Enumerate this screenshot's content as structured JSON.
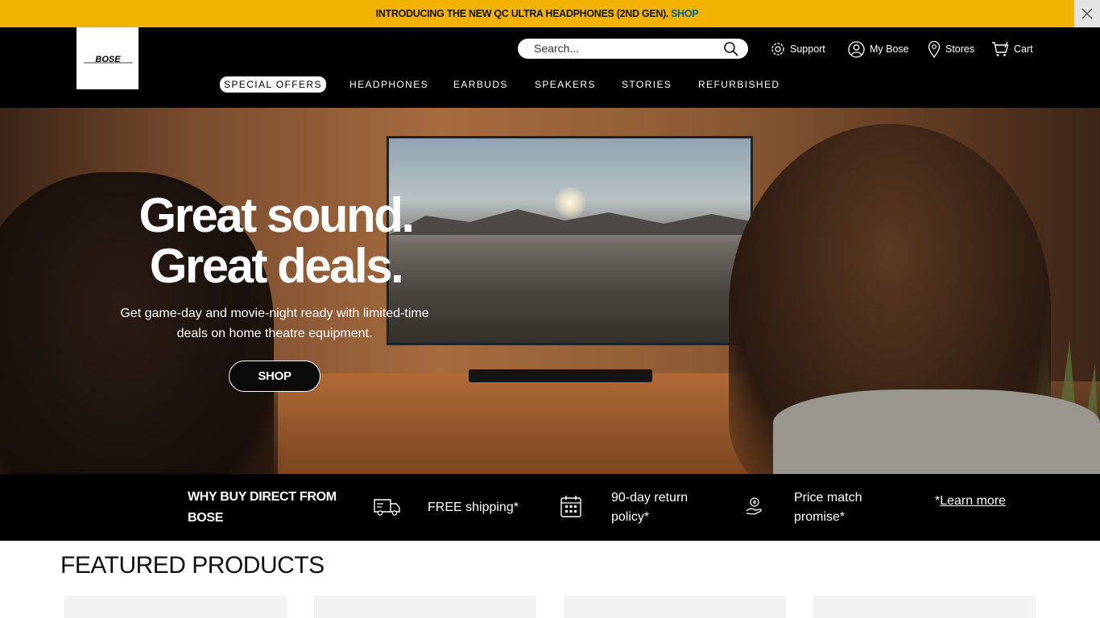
{
  "promo": {
    "text": "INTRODUCING THE NEW QC ULTRA HEADPHONES (2ND GEN).",
    "link": "SHOP"
  },
  "header": {
    "logo_text": "BOSE",
    "search_placeholder": "Search...",
    "utils": [
      "Support",
      "My Bose",
      "Stores",
      "Cart"
    ],
    "nav": [
      "SPECIAL OFFERS",
      "HEADPHONES",
      "EARBUDS",
      "SPEAKERS",
      "STORIES",
      "REFURBISHED"
    ]
  },
  "hero": {
    "title_line1": "Great sound.",
    "title_line2": "Great deals.",
    "subtitle": "Get game-day and movie-night ready with limited-time deals on home theatre equipment.",
    "button": "SHOP"
  },
  "benefits": {
    "heading": "WHY BUY DIRECT FROM BOSE",
    "items": [
      {
        "icon": "truck-icon",
        "text": "FREE shipping*"
      },
      {
        "icon": "calendar-icon",
        "text": "90-day return policy*"
      },
      {
        "icon": "hand-coin-icon",
        "text": "Price match promise*"
      }
    ],
    "learn_prefix": "*",
    "learn_link": "Learn more"
  },
  "featured": {
    "title": "FEATURED PRODUCTS"
  },
  "colors": {
    "promo_bg": "#f1b300",
    "promo_link": "#0b5f8a",
    "header_bg": "#000000",
    "text_light": "#ffffff"
  }
}
